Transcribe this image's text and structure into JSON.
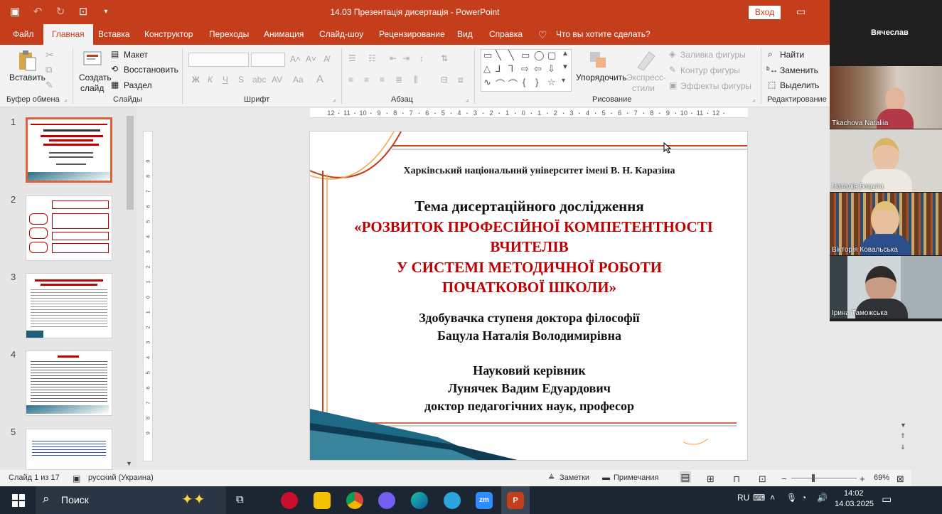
{
  "window": {
    "doc_title": "14.03 Презентація дисертація - PowerPoint",
    "signin": "Вход"
  },
  "tabs": [
    "Файл",
    "Главная",
    "Вставка",
    "Конструктор",
    "Переходы",
    "Анимация",
    "Слайд-шоу",
    "Рецензирование",
    "Вид",
    "Справка"
  ],
  "tell_me": "Что вы хотите сделать?",
  "ribbon": {
    "clipboard": {
      "paste": "Вставить",
      "group": "Буфер обмена"
    },
    "slides": {
      "new_slide": "Создать",
      "new_slide2": "слайд",
      "layout": "Макет",
      "reset": "Восстановить",
      "section": "Раздел",
      "group": "Слайды"
    },
    "font": {
      "group": "Шрифт"
    },
    "paragraph": {
      "group": "Абзац"
    },
    "drawing": {
      "arrange": "Упорядочить",
      "quick_styles": "Экспресс-",
      "quick_styles2": "стили",
      "fill": "Заливка фигуры",
      "outline": "Контур фигуры",
      "effects": "Эффекты фигуры",
      "group": "Рисование"
    },
    "editing": {
      "find": "Найти",
      "replace": "Заменить",
      "select": "Выделить",
      "group": "Редактирование"
    }
  },
  "participants": {
    "header_name": "Вячеслав",
    "tiles": [
      "Tkachova Nataliia",
      "Наталія Бацула",
      "Вікторія Ковальська",
      "Ірина Таможська"
    ]
  },
  "thumbnails": [
    "1",
    "2",
    "3",
    "4",
    "5"
  ],
  "slide": {
    "university": "Харківський національний університет імені В. Н. Каразіна",
    "topic_label": "Тема дисертаційного дослідження",
    "topic_line1": "«РОЗВИТОК ПРОФЕСІЙНОЇ КОМПЕТЕНТНОСТІ",
    "topic_line2": "ВЧИТЕЛІВ",
    "topic_line3": "У СИСТЕМІ МЕТОДИЧНОЇ РОБОТИ",
    "topic_line4": "ПОЧАТКОВОЇ ШКОЛИ»",
    "applicant_label": "Здобувачка ступеня доктора філософії",
    "applicant_name": "Бацула Наталія Володимирівна",
    "supervisor_label": "Науковий керівник",
    "supervisor_name": "Лунячек Вадим Едуардович",
    "supervisor_title": "доктор педагогічних наук, професор"
  },
  "status": {
    "slide_count": "Слайд 1 из 17",
    "language": "русский (Украина)",
    "notes": "Заметки",
    "comments": "Примечания",
    "zoom": "69%"
  },
  "taskbar": {
    "search": "Поиск",
    "lang": "RU",
    "time": "14:02",
    "date": "14.03.2025"
  },
  "colors": {
    "accent": "#c43e1c",
    "slide_red": "#c00000",
    "taskbar": "#1c2632"
  }
}
